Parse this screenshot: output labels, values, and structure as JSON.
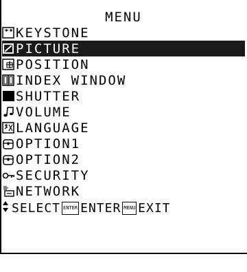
{
  "menu": {
    "title": "MENU",
    "items": [
      {
        "label": "KEYSTONE",
        "icon": "keystone-icon"
      },
      {
        "label": "PICTURE",
        "icon": "picture-icon",
        "selected": true
      },
      {
        "label": "POSITION",
        "icon": "position-icon"
      },
      {
        "label": "INDEX WINDOW",
        "icon": "index-window-icon"
      },
      {
        "label": "SHUTTER",
        "icon": "shutter-icon"
      },
      {
        "label": "VOLUME",
        "icon": "volume-icon"
      },
      {
        "label": "LANGUAGE",
        "icon": "language-icon"
      },
      {
        "label": "OPTION1",
        "icon": "option-icon"
      },
      {
        "label": "OPTION2",
        "icon": "option-icon"
      },
      {
        "label": "SECURITY",
        "icon": "key-icon"
      },
      {
        "label": "NETWORK",
        "icon": "network-icon"
      }
    ],
    "footer": {
      "select_label": "SELECT",
      "enter_btn": "ENTER",
      "enter_label": "ENTER",
      "menu_btn": "MENU",
      "exit_label": "EXIT"
    },
    "colors": {
      "selected_bg": "#1a1a1a",
      "selected_fg": "#ffffff"
    }
  }
}
